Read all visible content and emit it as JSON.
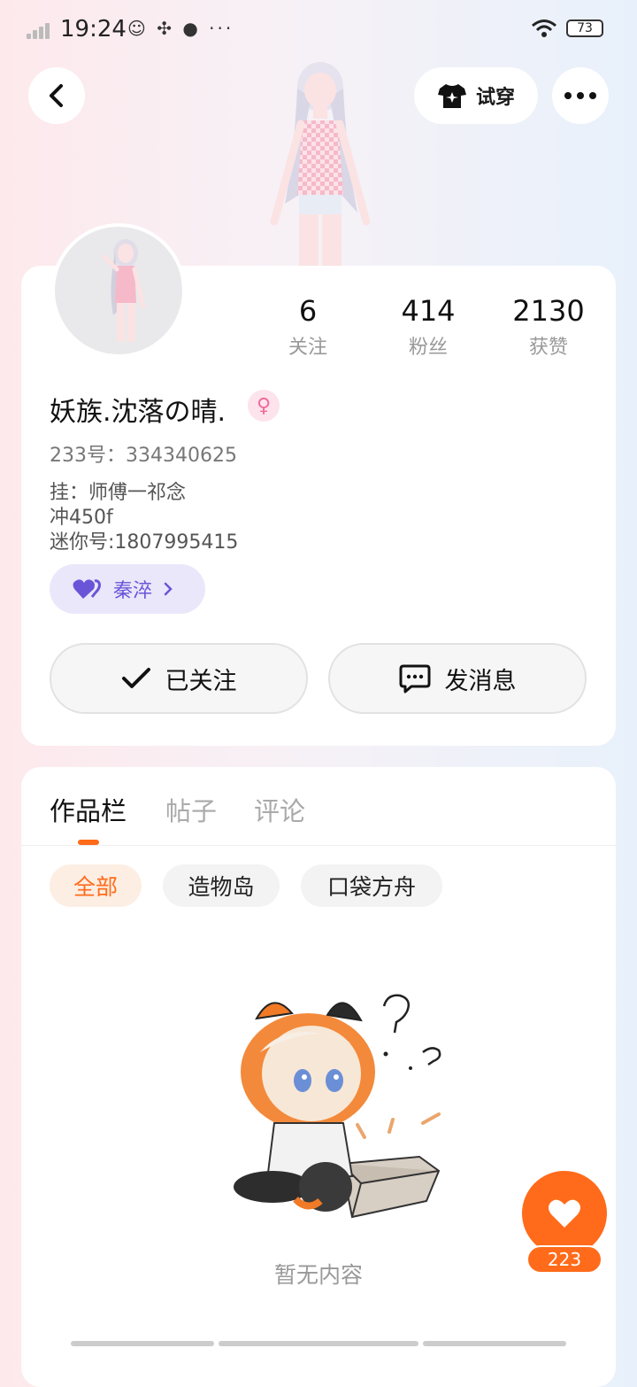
{
  "status_bar": {
    "time": "19:24",
    "battery": "73",
    "extra_icons": "☺ ✣ ● ···"
  },
  "header": {
    "tryon_label": "试穿"
  },
  "profile": {
    "stats": [
      {
        "value": "6",
        "label": "关注"
      },
      {
        "value": "414",
        "label": "粉丝"
      },
      {
        "value": "2130",
        "label": "获赞"
      }
    ],
    "nickname": "妖族.沈落の晴.",
    "gender_symbol": "♀",
    "user_id": "233号：334340625",
    "bio": [
      "挂：师傅一祁念",
      "冲450f",
      "迷你号:1807995415"
    ],
    "relation_name": "秦淬",
    "follow_label": "已关注",
    "message_label": "发消息"
  },
  "works": {
    "tabs": [
      "作品栏",
      "帖子",
      "评论"
    ],
    "filters": [
      "全部",
      "造物岛",
      "口袋方舟"
    ],
    "empty_text": "暂无内容"
  },
  "like": {
    "count": "223"
  },
  "colors": {
    "accent": "#ff6b1a",
    "relation": "#6a55d8",
    "relation_bg": "#ebe7fb"
  }
}
